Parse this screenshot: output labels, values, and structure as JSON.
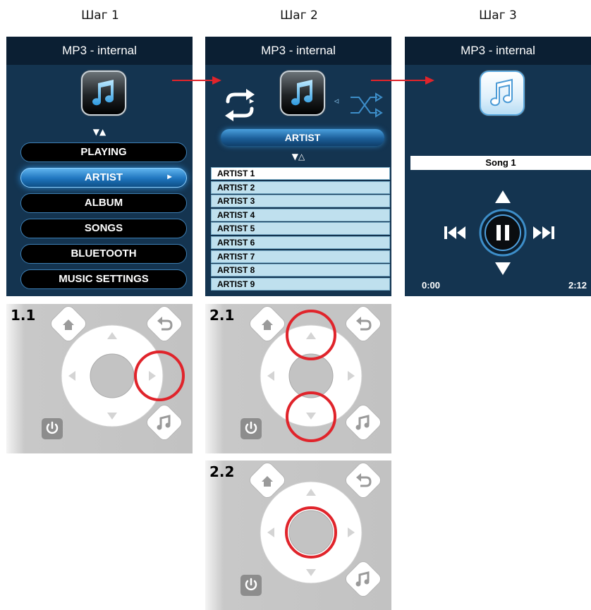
{
  "steps": [
    "Шаг 1",
    "Шаг 2",
    "Шаг 3"
  ],
  "screen1": {
    "header": "MP3 - internal",
    "nav_glyph": "▼▲",
    "menu": [
      {
        "label": "PLAYING",
        "active": false
      },
      {
        "label": "ARTIST",
        "active": true,
        "caret": "►"
      },
      {
        "label": "ALBUM",
        "active": false
      },
      {
        "label": "SONGS",
        "active": false
      },
      {
        "label": "BLUETOOTH",
        "active": false
      },
      {
        "label": "MUSIC SETTINGS",
        "active": false
      }
    ]
  },
  "screen2": {
    "header": "MP3 - internal",
    "left_indicator": "▸",
    "right_indicator": "◃",
    "category": "ARTIST",
    "nav_glyph": "▼△",
    "list": [
      "ARTIST 1",
      "ARTIST 2",
      "ARTIST 3",
      "ARTIST 4",
      "ARTIST 5",
      "ARTIST 6",
      "ARTIST 7",
      "ARTIST 8",
      "ARTIST 9"
    ],
    "selected_index": 0
  },
  "screen3": {
    "header": "MP3 - internal",
    "song": "Song 1",
    "elapsed": "0:00",
    "duration": "2:12"
  },
  "remotes": [
    {
      "label": "1.1",
      "highlight": "right"
    },
    {
      "label": "2.1",
      "highlight": "up-down"
    },
    {
      "label": "2.2",
      "highlight": "center"
    }
  ],
  "colors": {
    "screen_bg": "#143450",
    "header_bg": "#0b1f33",
    "highlight_ring": "#e0242b",
    "arrow": "#e0242b",
    "active_pill": "#1e74bd"
  },
  "icons": [
    "music-note-icon",
    "repeat-icon",
    "shuffle-icon",
    "previous-icon",
    "pause-icon",
    "next-icon",
    "home-icon",
    "back-icon",
    "power-icon"
  ]
}
